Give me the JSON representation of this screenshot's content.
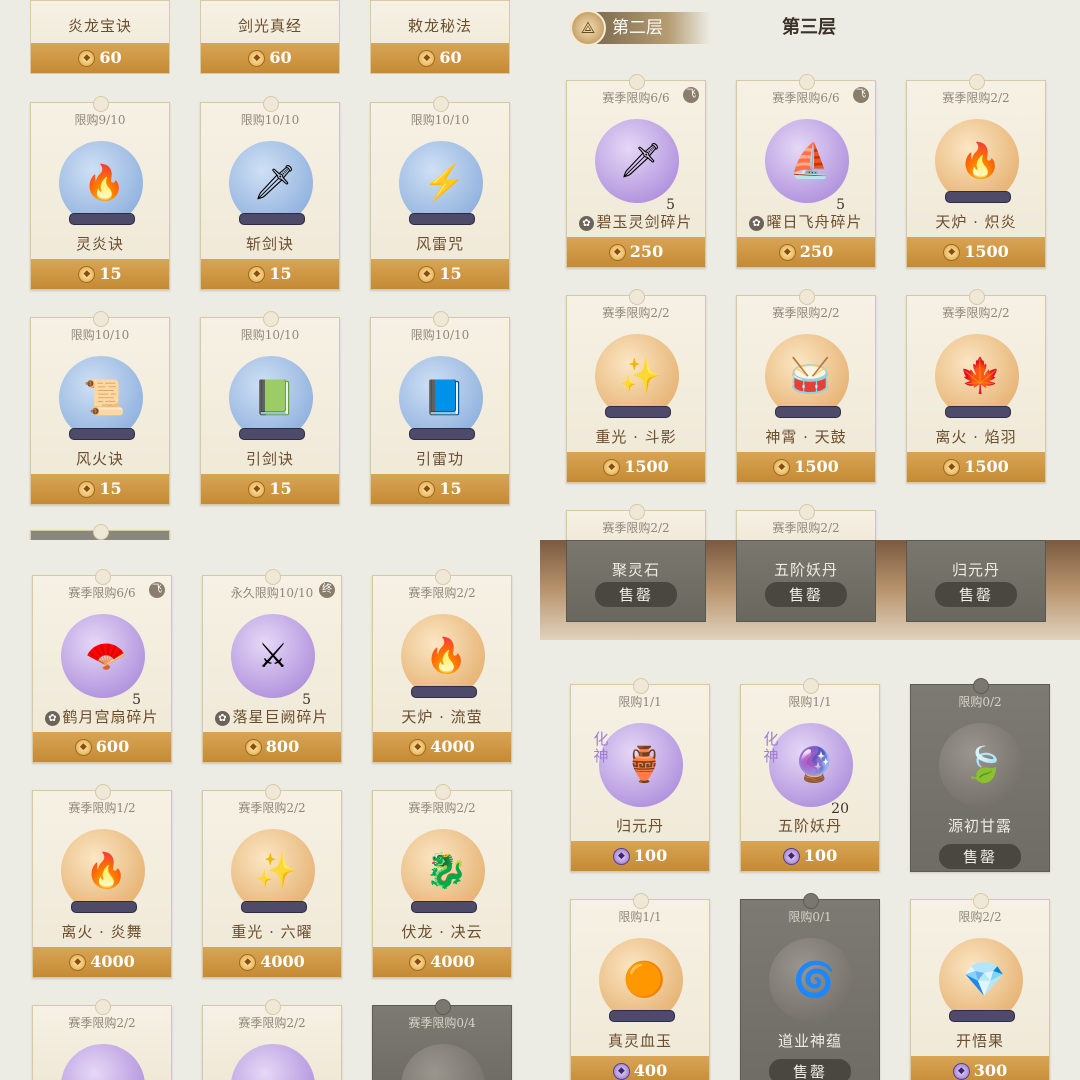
{
  "tl": {
    "top_row": [
      {
        "name": "炎龙宝诀",
        "price": "60"
      },
      {
        "name": "剑光真经",
        "price": "60"
      },
      {
        "name": "敕龙秘法",
        "price": "60"
      }
    ],
    "rows": [
      [
        {
          "limit": "限购9/10",
          "name": "灵炎诀",
          "price": "15",
          "color": "c-blue",
          "icon": "🔥"
        },
        {
          "limit": "限购10/10",
          "name": "斩剑诀",
          "price": "15",
          "color": "c-blue",
          "icon": "🗡"
        },
        {
          "limit": "限购10/10",
          "name": "风雷咒",
          "price": "15",
          "color": "c-blue",
          "icon": "⚡"
        }
      ],
      [
        {
          "limit": "限购10/10",
          "name": "风火诀",
          "price": "15",
          "color": "c-blue",
          "icon": "📜"
        },
        {
          "limit": "限购10/10",
          "name": "引剑诀",
          "price": "15",
          "color": "c-blue",
          "icon": "📗"
        },
        {
          "limit": "限购10/10",
          "name": "引雷功",
          "price": "15",
          "color": "c-blue",
          "icon": "📘"
        }
      ]
    ]
  },
  "tr": {
    "tabs": {
      "active": "第二层",
      "inactive": "第三层"
    },
    "rows": [
      [
        {
          "limit": "赛季限购6/6",
          "tag": "飞",
          "name": "碧玉灵剑碎片",
          "frag": true,
          "qty": "5",
          "price": "250",
          "color": "c-purple",
          "icon": "🗡"
        },
        {
          "limit": "赛季限购6/6",
          "tag": "飞",
          "name": "曜日飞舟碎片",
          "frag": true,
          "qty": "5",
          "price": "250",
          "color": "c-purple",
          "icon": "⛵"
        },
        {
          "limit": "赛季限购2/2",
          "name": "天炉 · 炽炎",
          "price": "1500",
          "color": "c-orange",
          "icon": "🔥"
        }
      ],
      [
        {
          "limit": "赛季限购2/2",
          "name": "重光 · 斗影",
          "price": "1500",
          "color": "c-orange",
          "icon": "✨"
        },
        {
          "limit": "赛季限购2/2",
          "name": "神霄 · 天鼓",
          "price": "1500",
          "color": "c-orange",
          "icon": "🥁"
        },
        {
          "limit": "赛季限购2/2",
          "name": "离火 · 焰羽",
          "price": "1500",
          "color": "c-orange",
          "icon": "🍁"
        }
      ]
    ],
    "partial": [
      {
        "limit": "赛季限购2/2"
      },
      {
        "limit": "赛季限购2/2"
      }
    ]
  },
  "bl": {
    "rows": [
      [
        {
          "limit": "赛季限购6/6",
          "tag": "飞",
          "name": "鹤月宫扇碎片",
          "frag": true,
          "qty": "5",
          "price": "600",
          "color": "c-purple",
          "icon": "🪭"
        },
        {
          "limit": "永久限购10/10",
          "tag": "终",
          "name": "落星巨阙碎片",
          "frag": true,
          "qty": "5",
          "price": "800",
          "color": "c-purple",
          "icon": "⚔"
        },
        {
          "limit": "赛季限购2/2",
          "name": "天炉 · 流萤",
          "price": "4000",
          "color": "c-orange",
          "icon": "🔥"
        }
      ],
      [
        {
          "limit": "赛季限购1/2",
          "name": "离火 · 炎舞",
          "price": "4000",
          "color": "c-orange",
          "icon": "🔥"
        },
        {
          "limit": "赛季限购2/2",
          "name": "重光 · 六曜",
          "price": "4000",
          "color": "c-orange",
          "icon": "✨"
        },
        {
          "limit": "赛季限购2/2",
          "name": "伏龙 · 决云",
          "price": "4000",
          "color": "c-orange",
          "icon": "🐉"
        }
      ]
    ],
    "partial": [
      {
        "limit": "赛季限购2/2",
        "grey": false
      },
      {
        "limit": "赛季限购2/2",
        "grey": false
      },
      {
        "limit": "赛季限购0/4",
        "grey": true
      }
    ]
  },
  "br": {
    "shelf": [
      {
        "name": "聚灵石",
        "status": "售罄"
      },
      {
        "name": "五阶妖丹",
        "status": "售罄"
      },
      {
        "name": "归元丹",
        "status": "售罄"
      }
    ],
    "rows": [
      [
        {
          "limit": "限购1/1",
          "side": "化神",
          "name": "归元丹",
          "price": "100",
          "coin": "purple",
          "color": "c-purple",
          "icon": "🏺"
        },
        {
          "limit": "限购1/1",
          "side": "化神",
          "name": "五阶妖丹",
          "qty": "20",
          "price": "100",
          "coin": "purple",
          "color": "c-purple",
          "icon": "🔮"
        },
        {
          "limit": "限购0/2",
          "name": "源初甘露",
          "status": "售罄",
          "grey": true,
          "color": "c-grey",
          "icon": "🍃"
        }
      ],
      [
        {
          "limit": "限购1/1",
          "name": "真灵血玉",
          "price": "400",
          "coin": "purple",
          "color": "c-orange",
          "icon": "🟠"
        },
        {
          "limit": "限购0/1",
          "name": "道业神蕴",
          "status": "售罄",
          "grey": true,
          "color": "c-grey",
          "icon": "🌀"
        },
        {
          "limit": "限购2/2",
          "name": "开悟果",
          "price": "300",
          "coin": "purple",
          "color": "c-orange",
          "icon": "💎"
        }
      ]
    ]
  }
}
